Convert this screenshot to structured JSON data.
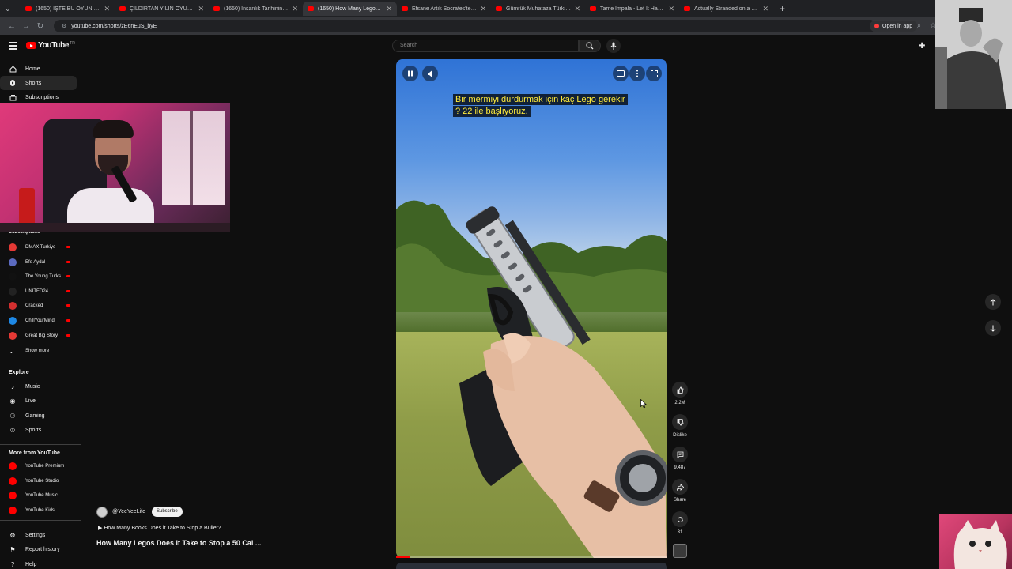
{
  "browser": {
    "tabs": [
      {
        "title": "(1650) İŞTE BU OYUN OYNANI…",
        "active": false
      },
      {
        "title": "ÇILDIRTAN YILIN OYUNU ADAY…",
        "active": false
      },
      {
        "title": "(1650) İnsanlık Tarihinin En Teh…",
        "active": false
      },
      {
        "title": "(1650) How Many Legos D…",
        "active": true
      },
      {
        "title": "Efsane Artık Socrates'te, Ada Fe…",
        "active": false
      },
      {
        "title": "Gümrük Muhafaza Türkiye 24…",
        "active": false
      },
      {
        "title": "Tame Impala - Let It Happen (O…",
        "active": false
      },
      {
        "title": "Actually Stranded on a Desert…",
        "active": false
      }
    ],
    "url": "youtube.com/shorts/zE6nEuS_byE",
    "open_in_app": "Open in app"
  },
  "header": {
    "logo_text": "YouTube",
    "logo_suffix": "TR",
    "search_placeholder": "Search"
  },
  "sidebar": {
    "main_items": [
      {
        "label": "Home",
        "icon": "home-icon",
        "active": false
      },
      {
        "label": "Shorts",
        "icon": "shorts-icon",
        "active": true
      },
      {
        "label": "Subscriptions",
        "icon": "subscriptions-icon",
        "active": false
      }
    ],
    "subscriptions_heading": "Subscriptions",
    "subscriptions": [
      {
        "label": "DMAX Turkiye",
        "color": "#e53935"
      },
      {
        "label": "Efe Aydal",
        "color": "#5c6bc0"
      },
      {
        "label": "The Young Turks",
        "color": "#111111"
      },
      {
        "label": "UNITED24",
        "color": "#222222"
      },
      {
        "label": "Cracked",
        "color": "#d32f2f"
      },
      {
        "label": "ChillYourMind",
        "color": "#1e88e5"
      },
      {
        "label": "Great Big Story",
        "color": "#e53935"
      }
    ],
    "show_more": "Show more",
    "explore_heading": "Explore",
    "explore": [
      {
        "label": "Music",
        "icon": "music-icon"
      },
      {
        "label": "Live",
        "icon": "live-icon"
      },
      {
        "label": "Gaming",
        "icon": "gaming-icon"
      },
      {
        "label": "Sports",
        "icon": "trophy-icon"
      }
    ],
    "more_heading": "More from YouTube",
    "more": [
      {
        "label": "YouTube Premium"
      },
      {
        "label": "YouTube Studio"
      },
      {
        "label": "YouTube Music"
      },
      {
        "label": "YouTube Kids"
      }
    ],
    "bottom": [
      {
        "label": "Settings",
        "icon": "settings-icon"
      },
      {
        "label": "Report history",
        "icon": "flag-icon"
      },
      {
        "label": "Help",
        "icon": "help-icon"
      }
    ]
  },
  "video": {
    "caption_line1": "Bir mermiyi durdurmak için kaç Lego gerekir",
    "caption_line2": "? 22 ile başlıyoruz.",
    "progress_fraction": 0.05
  },
  "actions": {
    "likes": "2.2M",
    "dislike": "Dislike",
    "comments": "9,487",
    "share": "Share",
    "remix": "31"
  },
  "meta": {
    "channel_handle": "@YeeYeeLife",
    "subscribe_label": "Subscribe",
    "playlist_label": "How Many Books Does it Take to Stop a Bullet?",
    "title": "How Many Legos Does it Take to Stop a 50 Cal ..."
  }
}
